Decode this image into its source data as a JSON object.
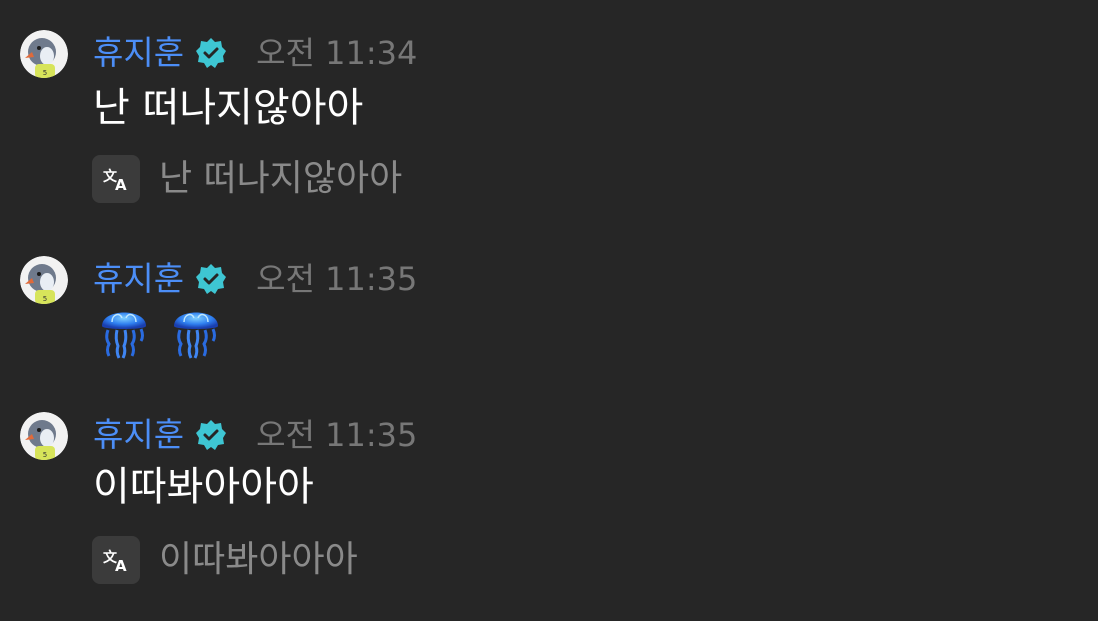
{
  "messages": [
    {
      "author": "휴지훈",
      "time": "오전 11:34",
      "text": "난 떠나지않아아",
      "translation": "난 떠나지않아아",
      "icons": {
        "avatar": "penguin-avatar-icon",
        "verified": "verified-badge-icon",
        "translate": "translate-icon"
      }
    },
    {
      "author": "휴지훈",
      "time": "오전 11:35",
      "emojis": [
        "jellyfish-emoji",
        "jellyfish-emoji"
      ]
    },
    {
      "author": "휴지훈",
      "time": "오전 11:35",
      "text": "이따봐아아아",
      "translation": "이따봐아아아"
    }
  ],
  "colors": {
    "background": "#262626",
    "author_name": "#4c8ef7",
    "verified_badge": "#3ec6d3",
    "timestamp": "#777777",
    "message_text": "#ffffff",
    "translation_text": "#8a8a8a"
  }
}
